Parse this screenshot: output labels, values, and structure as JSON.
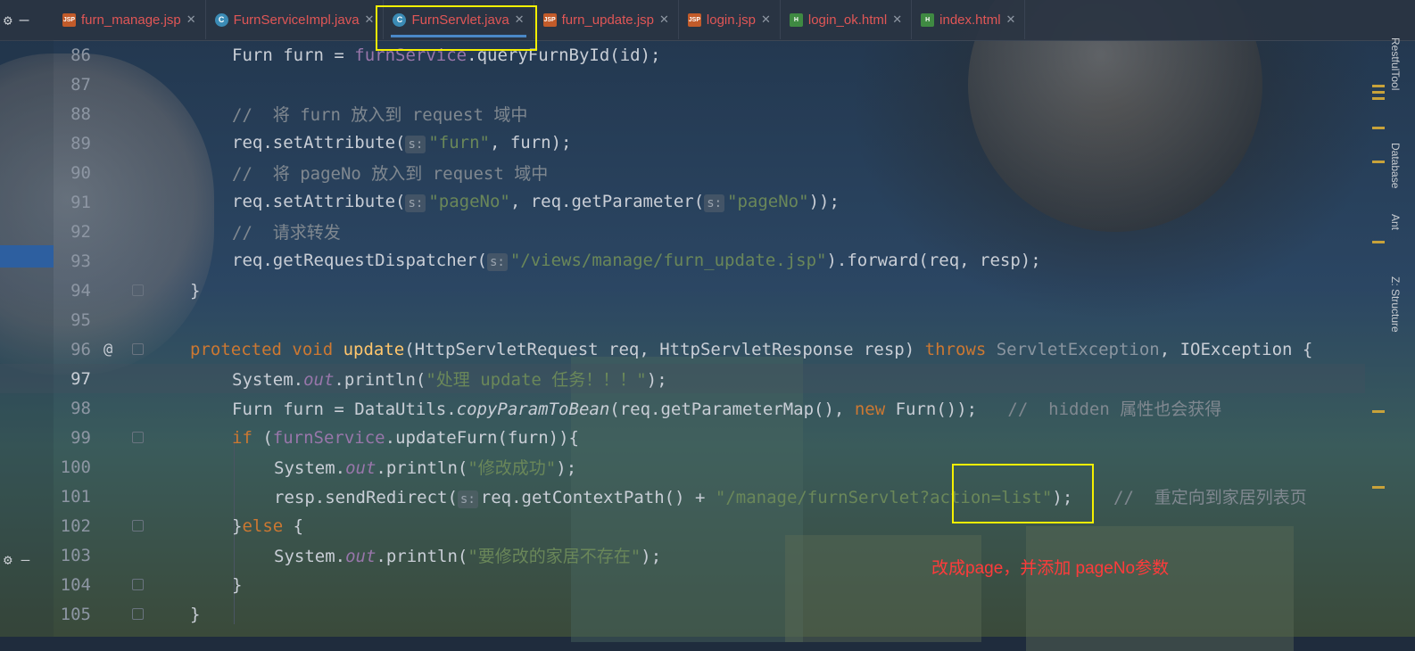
{
  "tabs": [
    {
      "label": "furn_manage.jsp",
      "type": "jsp",
      "icon": "jsp-file-icon"
    },
    {
      "label": "FurnServiceImpl.java",
      "type": "java",
      "icon": "java-class-icon"
    },
    {
      "label": "FurnServlet.java",
      "type": "java",
      "icon": "java-class-icon",
      "active": true
    },
    {
      "label": "furn_update.jsp",
      "type": "jsp",
      "icon": "jsp-file-icon"
    },
    {
      "label": "login.jsp",
      "type": "jsp",
      "icon": "jsp-file-icon"
    },
    {
      "label": "login_ok.html",
      "type": "html",
      "icon": "html-file-icon"
    },
    {
      "label": "index.html",
      "type": "html",
      "icon": "html-file-icon"
    }
  ],
  "icon_labels": {
    "jsp": "JSP",
    "java": "C",
    "html": "H"
  },
  "line_numbers": [
    "86",
    "87",
    "88",
    "89",
    "90",
    "91",
    "92",
    "93",
    "94",
    "95",
    "96",
    "97",
    "98",
    "99",
    "100",
    "101",
    "102",
    "103",
    "104",
    "105"
  ],
  "gutter_marker": "@",
  "param_hint": "s:",
  "code": {
    "l86": {
      "a": "Furn furn = ",
      "b": "furnService",
      "c": ".queryFurnById(id);"
    },
    "l88": "//  将 furn 放入到 request 域中",
    "l89": {
      "a": "req.setAttribute(",
      "b": "\"furn\"",
      "c": ", furn);"
    },
    "l90": "//  将 pageNo 放入到 request 域中",
    "l91": {
      "a": "req.setAttribute(",
      "b": "\"pageNo\"",
      "c": ", req.getParameter(",
      "d": "\"pageNo\"",
      "e": "));"
    },
    "l92": "//  请求转发",
    "l93": {
      "a": "req.getRequestDispatcher(",
      "b": "\"/views/manage/furn_update.jsp\"",
      "c": ").forward(req, resp);"
    },
    "l94": "}",
    "l96": {
      "a": "protected void ",
      "b": "update",
      "c": "(HttpServletRequest req, HttpServletResponse resp) ",
      "d": "throws ",
      "e": "ServletException",
      "f": ", IOException {"
    },
    "l97": {
      "a": "System.",
      "b": "out",
      "c": ".println(",
      "d": "\"处理 update 任务！！！\"",
      "e": ");"
    },
    "l98": {
      "a": "Furn furn = DataUtils.",
      "b": "copyParamToBean",
      "c": "(req.getParameterMap(), ",
      "d": "new ",
      "e": "Furn());",
      "f": "   //  hidden 属性也会获得"
    },
    "l99": {
      "a": "if ",
      "b": "(",
      "c": "furnService",
      "d": ".updateFurn(furn)){"
    },
    "l100": {
      "a": "System.",
      "b": "out",
      "c": ".println(",
      "d": "\"修改成功\"",
      "e": ");"
    },
    "l101": {
      "a": "resp.sendRedirect(",
      "b": "req.getContextPath() + ",
      "c": "\"/manage/furnServlet?action=list\"",
      "d": ");",
      "e": "    //  重定向到家居列表页"
    },
    "l102": {
      "a": "}",
      "b": "else ",
      "c": "{"
    },
    "l103": {
      "a": "System.",
      "b": "out",
      "c": ".println(",
      "d": "\"要修改的家居不存在\"",
      "e": ");"
    },
    "l104": "}",
    "l105": "}"
  },
  "annotation": "改成page，并添加 pageNo参数",
  "side_labels": [
    "RestfulTool",
    "Database",
    "Ant",
    "Z: Structure"
  ],
  "colors": {
    "keyword": "#cc7832",
    "string": "#6a8759",
    "comment": "#808890",
    "method": "#ffc66d",
    "field": "#9876aa",
    "highlight": "#f5f000",
    "annotation": "#ff3b3b"
  }
}
